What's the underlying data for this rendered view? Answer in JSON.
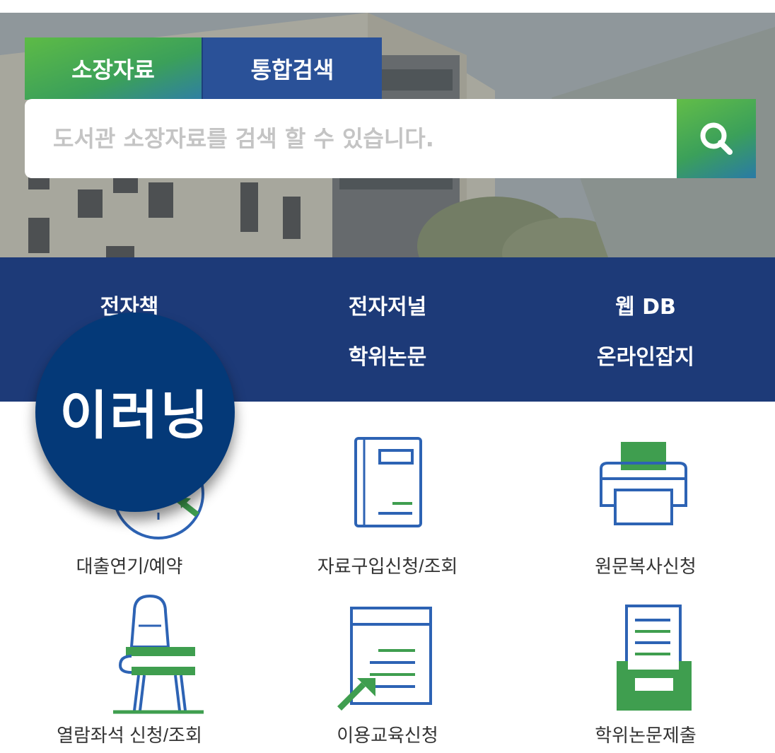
{
  "search": {
    "tabs": [
      "소장자료",
      "통합검색"
    ],
    "placeholder": "도서관 소장자료를 검색 할 수 있습니다."
  },
  "eresources": [
    "전자책",
    "전자저널",
    "웹 DB",
    "학위논문",
    "온라인잡지"
  ],
  "elearning_label": "이러닝",
  "services": [
    {
      "label": "대출연기/예약",
      "icon": "clock-arrow-icon"
    },
    {
      "label": "자료구입신청/조회",
      "icon": "book-icon"
    },
    {
      "label": "원문복사신청",
      "icon": "printer-icon"
    },
    {
      "label": "열람좌석 신청/조회",
      "icon": "desk-chair-icon"
    },
    {
      "label": "이용교육신청",
      "icon": "document-arrow-icon"
    },
    {
      "label": "학위논문제출",
      "icon": "inbox-tray-icon"
    }
  ],
  "colors": {
    "navy": "#1d3a78",
    "blue": "#2a5198",
    "green": "#3f9e4f",
    "icon_blue": "#2d63b4"
  }
}
